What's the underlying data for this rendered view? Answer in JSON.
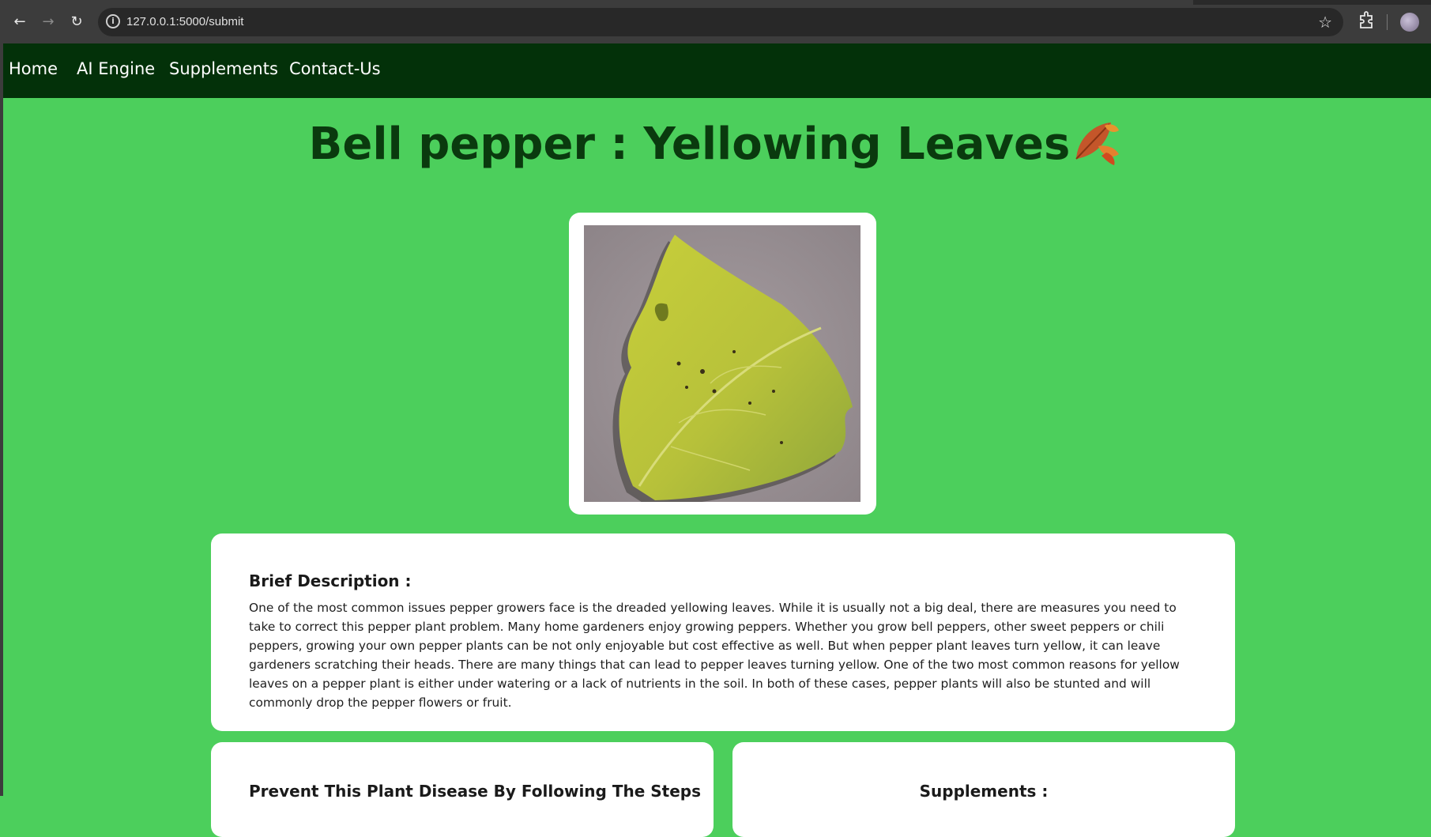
{
  "browser": {
    "url": "127.0.0.1:5000/submit",
    "icons": [
      "back-arrow-icon",
      "forward-arrow-icon",
      "reload-icon",
      "site-info-icon",
      "bookmark-star-icon",
      "extensions-icon",
      "profile-avatar-icon"
    ]
  },
  "nav": {
    "items": [
      {
        "label": "Home"
      },
      {
        "label": "AI Engine"
      },
      {
        "label": "Supplements"
      },
      {
        "label": "Contact-Us"
      }
    ]
  },
  "page": {
    "title": "Bell pepper : Yellowing Leaves",
    "title_emoji": "fallen-leaf-icon"
  },
  "description": {
    "heading": "Brief Description :",
    "text": "One of the most common issues pepper growers face is the dreaded yellowing leaves. While it is usually not a big deal, there are measures you need to take to correct this pepper plant problem. Many home gardeners enjoy growing peppers. Whether you grow bell peppers, other sweet peppers or chili peppers, growing your own pepper plants can be not only enjoyable but cost effective as well. But when pepper plant leaves turn yellow, it can leave gardeners scratching their heads. There are many things that can lead to pepper leaves turning yellow. One of the two most common reasons for yellow leaves on a pepper plant is either under watering or a lack of nutrients in the soil. In both of these cases, pepper plants will also be stunted and will commonly drop the pepper flowers or fruit."
  },
  "prevent": {
    "heading": "Prevent This Plant Disease By Following The Steps"
  },
  "supplements": {
    "heading": "Supplements :"
  },
  "colors": {
    "page_bg": "#4ccf5c",
    "nav_bg": "#033109",
    "title": "#0a3a0e"
  }
}
